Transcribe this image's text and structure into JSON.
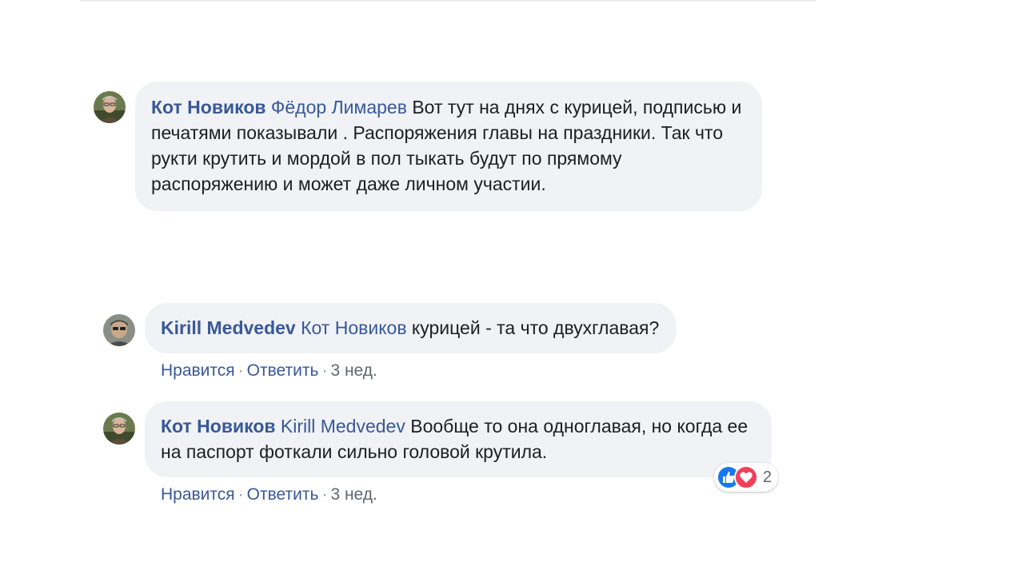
{
  "colors": {
    "link": "#385898",
    "bubble": "#f0f2f5",
    "like": "#1877f2",
    "love": "#f33e58"
  },
  "comments": [
    {
      "author": "Кот Новиков",
      "mention": "Фёдор Лимарев",
      "text": " Вот тут на днях с курицей, подписью и печатями показывали . Распоряжения главы на праздники. Так что рукти крутить и мордой в пол тыкать будут по прямому распоряжению и может даже личном участии."
    },
    {
      "author": "Kirill Medvedev",
      "mention": "Кот Новиков",
      "text": " курицей - та что двухглавая?",
      "like_label": "Нравится",
      "reply_label": "Ответить",
      "time": "3 нед."
    },
    {
      "author": "Кот Новиков",
      "mention": "Kirill Medvedev",
      "text": " Вообще то она одноглавая, но когда ее на паспорт фоткали сильно головой крутила.",
      "like_label": "Нравится",
      "reply_label": "Ответить",
      "time": "3 нед.",
      "reactions": {
        "icons": [
          "like-icon",
          "love-icon"
        ],
        "count": "2"
      }
    }
  ]
}
